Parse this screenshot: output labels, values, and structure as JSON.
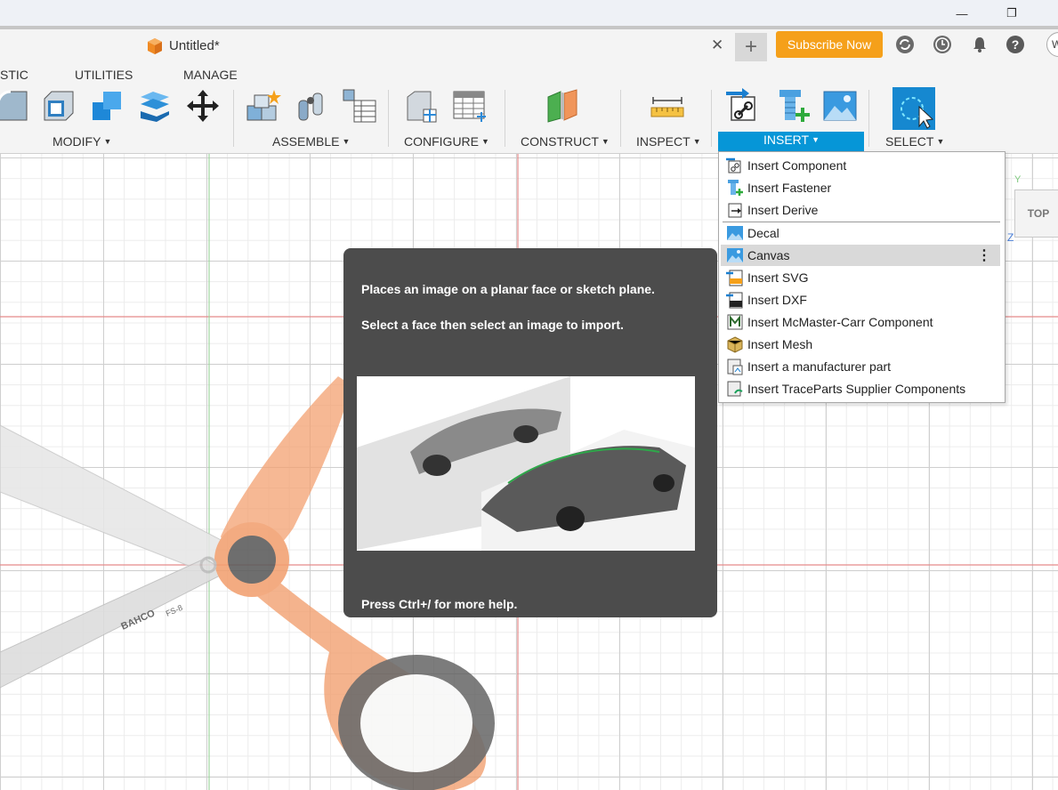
{
  "document": {
    "title": "Untitled*"
  },
  "subscribe_label": "Subscribe Now",
  "user_initial": "W",
  "workspace_tabs": [
    "STIC",
    "UTILITIES",
    "MANAGE"
  ],
  "ribbon_groups": [
    "MODIFY",
    "ASSEMBLE",
    "CONFIGURE",
    "CONSTRUCT",
    "INSPECT",
    "INSERT",
    "SELECT"
  ],
  "insert_menu": {
    "items": [
      "Insert Component",
      "Insert Fastener",
      "Insert Derive",
      "Decal",
      "Canvas",
      "Insert SVG",
      "Insert DXF",
      "Insert McMaster-Carr Component",
      "Insert Mesh",
      "Insert a manufacturer part",
      "Insert TraceParts Supplier Components"
    ],
    "highlighted": "Canvas",
    "more_glyph": "⋮"
  },
  "tooltip": {
    "line1": "Places an image on a planar face or sketch plane.",
    "line2": "Select a face then select an image to import.",
    "help": "Press Ctrl+/ for more help."
  },
  "viewcube": {
    "face": "TOP",
    "axis_y": "Y",
    "axis_z": "Z"
  },
  "scissors": {
    "brand": "BAHCO",
    "model": "FS-8"
  },
  "window": {
    "minimize_glyph": "—",
    "restore_glyph": "❐"
  },
  "colors": {
    "accent": "#0696d7",
    "subscribe": "#f5a01a",
    "handle": "#f2a070",
    "grip": "#5a5a5a"
  }
}
